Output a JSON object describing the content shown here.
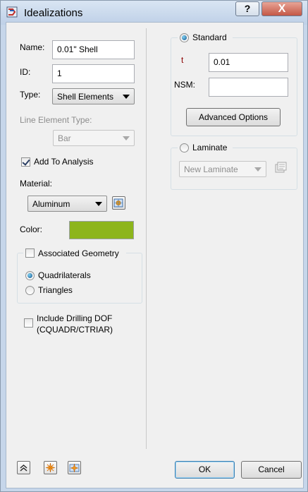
{
  "window": {
    "title": "Idealizations",
    "help_label": "?",
    "close_label": "X"
  },
  "left": {
    "name_label": "Name:",
    "name_value": "0.01\" Shell",
    "id_label": "ID:",
    "id_value": "1",
    "type_label": "Type:",
    "type_value": "Shell Elements",
    "line_element_label": "Line Element Type:",
    "line_element_value": "Bar",
    "add_to_analysis_label": "Add To Analysis",
    "add_to_analysis_checked": true,
    "material_label": "Material:",
    "material_value": "Aluminum",
    "color_label": "Color:",
    "color_value": "#8db51c",
    "assoc_geom_label": "Associated Geometry",
    "assoc_geom_checked": false,
    "quad_label": "Quadrilaterals",
    "tri_label": "Triangles",
    "mesh_selected": "Quadrilaterals",
    "drilling_label_1": "Include Drilling DOF",
    "drilling_label_2": "(CQUADR/CTRIAR)",
    "drilling_checked": false
  },
  "right": {
    "standard_label": "Standard",
    "standard_selected": true,
    "t_label": "t",
    "t_value": "0.01",
    "nsm_label": "NSM:",
    "nsm_value": "",
    "advanced_label": "Advanced Options",
    "laminate_label": "Laminate",
    "laminate_selected": false,
    "laminate_value": "New Laminate"
  },
  "footer": {
    "ok_label": "OK",
    "cancel_label": "Cancel"
  },
  "colors": {
    "accent": "#3c7fb1",
    "t_label_color": "#8b0000"
  }
}
